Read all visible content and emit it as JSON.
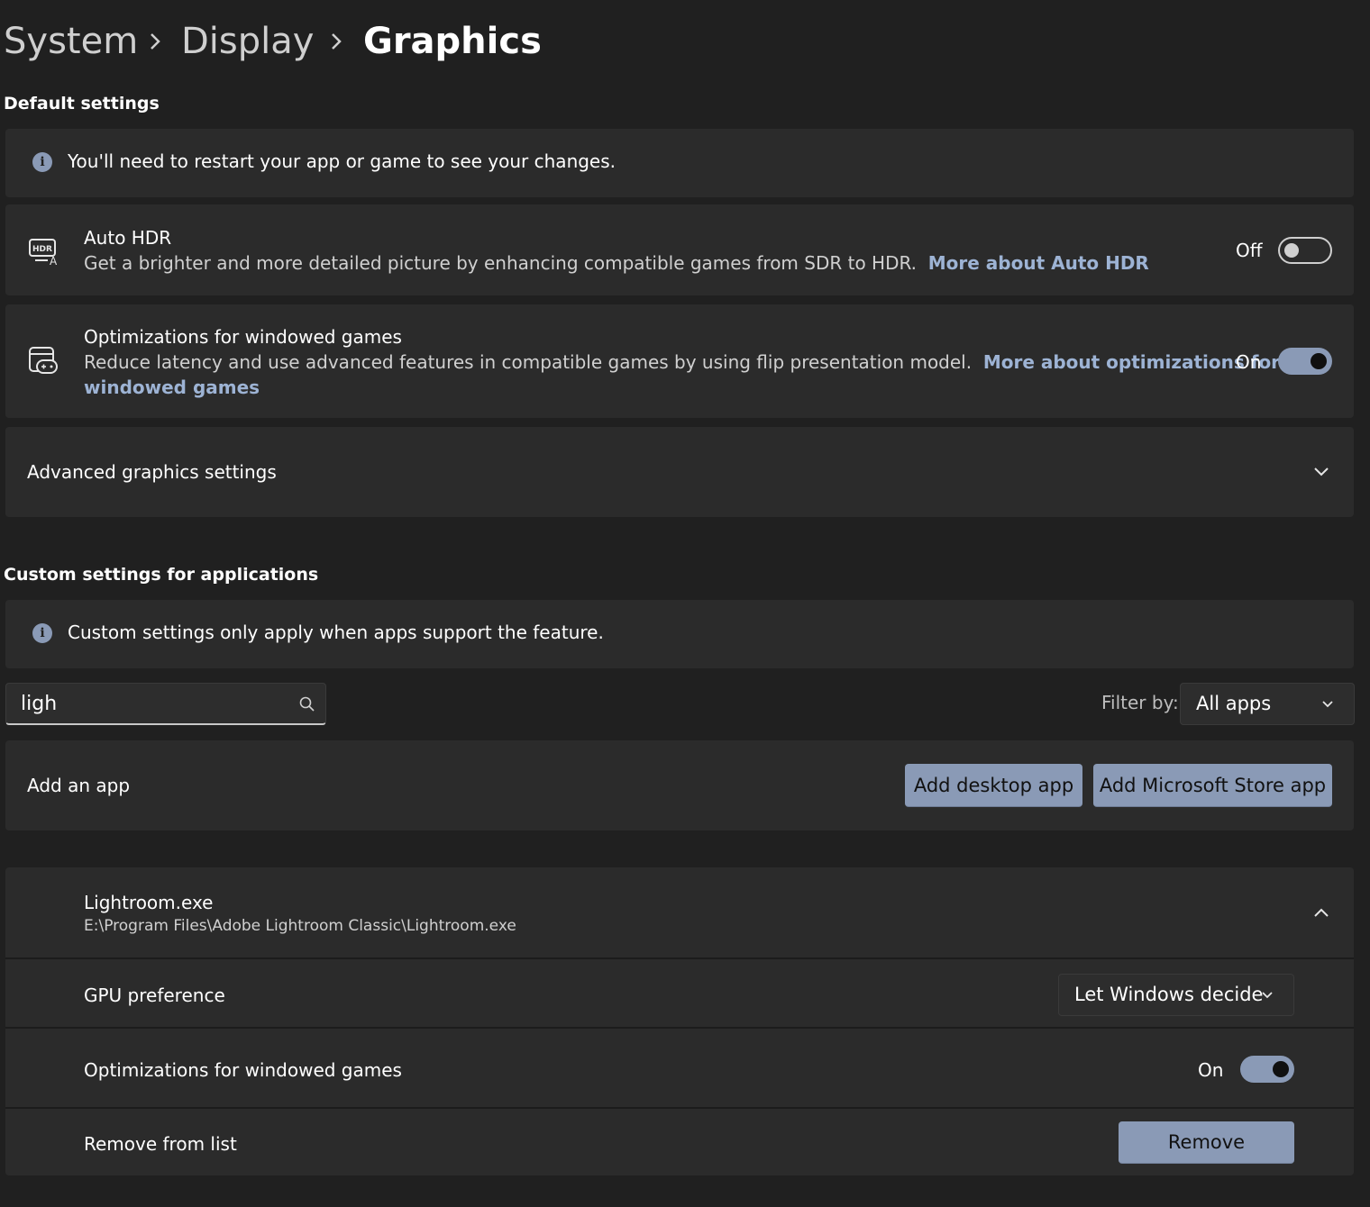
{
  "breadcrumb": {
    "items": [
      "System",
      "Display",
      "Graphics"
    ]
  },
  "default_settings": {
    "title": "Default settings",
    "info": "You'll need to restart your app or game to see your changes.",
    "auto_hdr": {
      "title": "Auto HDR",
      "description": "Get a brighter and more detailed picture by enhancing compatible games from SDR to HDR.",
      "link": "More about Auto HDR",
      "state": "Off"
    },
    "windowed_opt": {
      "title": "Optimizations for windowed games",
      "description": "Reduce latency and use advanced features in compatible games by using flip presentation model.",
      "link_line1": "More about optimizations for",
      "link_line2": "windowed games",
      "state": "On"
    },
    "advanced": {
      "label": "Advanced graphics settings"
    }
  },
  "custom_settings": {
    "title": "Custom settings for applications",
    "info": "Custom settings only apply when apps support the feature.",
    "search": {
      "value": "ligh"
    },
    "filter": {
      "label": "Filter by:",
      "value": "All apps"
    },
    "add_app": {
      "label": "Add an app",
      "desktop_button": "Add desktop app",
      "store_button": "Add Microsoft Store app"
    },
    "app": {
      "name": "Lightroom.exe",
      "path": "E:\\Program Files\\Adobe Lightroom Classic\\Lightroom.exe",
      "gpu_label": "GPU preference",
      "gpu_value": "Let Windows decide",
      "windowed_label": "Optimizations for windowed games",
      "windowed_state": "On",
      "remove_label": "Remove from list",
      "remove_button": "Remove"
    }
  },
  "colors": {
    "accent": "#8a9ab6",
    "link": "#9db3d4",
    "background": "#202020",
    "card": "#2b2b2b"
  }
}
